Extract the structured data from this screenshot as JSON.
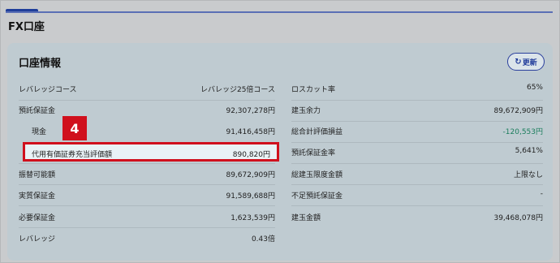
{
  "page_title": "FX口座",
  "panel": {
    "title": "口座情報",
    "refresh_label": "更新"
  },
  "left_rows": [
    {
      "label": "レバレッジコース",
      "value": "レバレッジ25倍コース"
    },
    {
      "label": "預託保証金",
      "value": "92,307,278円"
    },
    {
      "label": "現金",
      "value": "91,416,458円"
    },
    {
      "label": "代用有価証券充当評価額",
      "value": "890,820円"
    },
    {
      "label": "振替可能額",
      "value": "89,672,909円"
    },
    {
      "label": "実質保証金",
      "value": "91,589,688円"
    },
    {
      "label": "必要保証金",
      "value": "1,623,539円"
    },
    {
      "label": "レバレッジ",
      "value": "0.43倍"
    }
  ],
  "right_rows": [
    {
      "label": "ロスカット率",
      "value": "65%"
    },
    {
      "label": "建玉余力",
      "value": "89,672,909円"
    },
    {
      "label": "総合計評価損益",
      "value": "-120,553円"
    },
    {
      "label": "預託保証金率",
      "value": "5,641%"
    },
    {
      "label": "総建玉限度金額",
      "value": "上限なし"
    },
    {
      "label": "不足預託保証金",
      "value": "-"
    },
    {
      "label": "建玉金額",
      "value": "39,468,078円"
    }
  ],
  "step_badge": "4",
  "colors": {
    "accent": "#1f3e9a",
    "highlight_border": "#d0101d",
    "negative_value": "#1a7d5c"
  }
}
